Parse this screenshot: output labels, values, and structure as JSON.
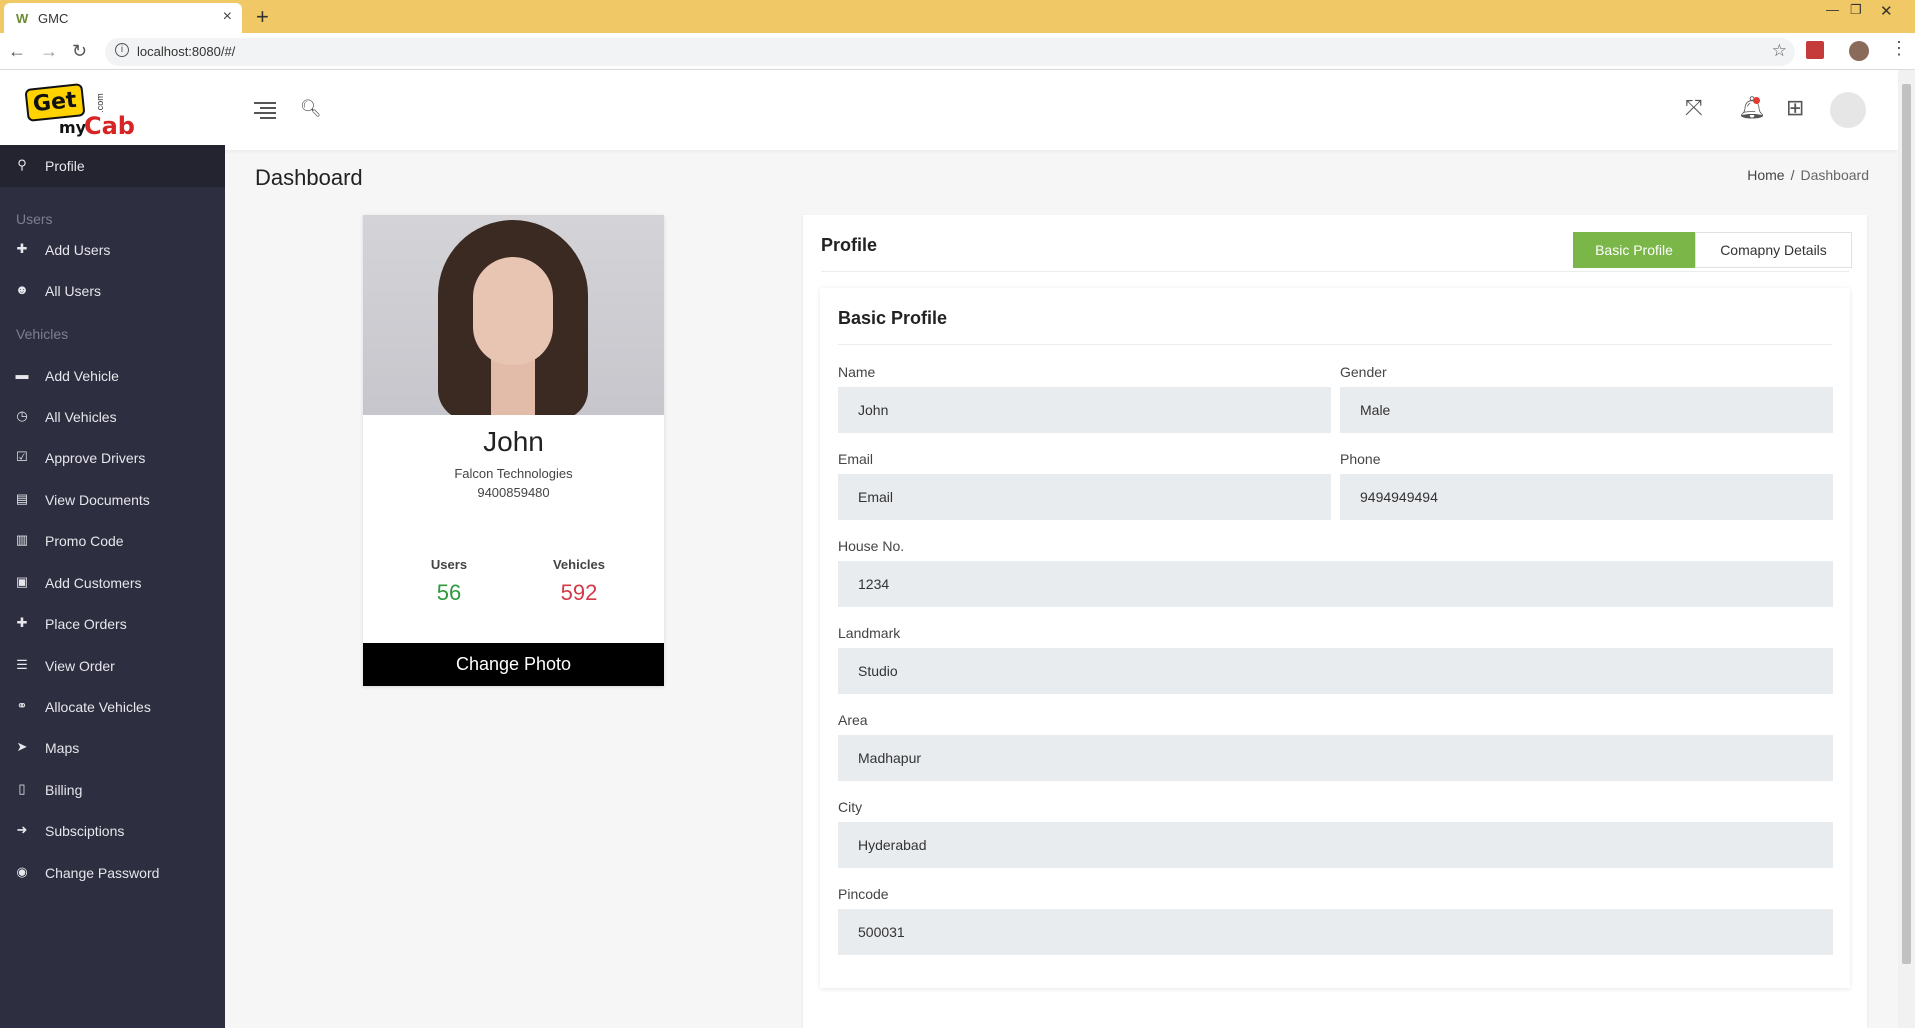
{
  "browser": {
    "tab_title": "GMC",
    "tab_favicon": "W",
    "url": "localhost:8080/#/"
  },
  "logo": {
    "get": "Get",
    "my": "my",
    "cab": "Cab",
    "com": ".com"
  },
  "sidebar": {
    "items": [
      {
        "label": "Profile",
        "icon": "user-icon",
        "glyph": "⚲"
      },
      {
        "section": "Users"
      },
      {
        "label": "Add Users",
        "icon": "add-user-icon",
        "glyph": "✚"
      },
      {
        "label": "All Users",
        "icon": "users-icon",
        "glyph": "☻"
      },
      {
        "section": "Vehicles"
      },
      {
        "label": "Add Vehicle",
        "icon": "car-icon",
        "glyph": "▬"
      },
      {
        "label": "All Vehicles",
        "icon": "clock-icon",
        "glyph": "◷"
      },
      {
        "label": "Approve Drivers",
        "icon": "calendar-check-icon",
        "glyph": "☑"
      },
      {
        "label": "View Documents",
        "icon": "document-icon",
        "glyph": "▤"
      },
      {
        "label": "Promo Code",
        "icon": "barcode-icon",
        "glyph": "▥"
      },
      {
        "label": "Add Customers",
        "icon": "calendar-plus-icon",
        "glyph": "▣"
      },
      {
        "label": "Place Orders",
        "icon": "plus-icon",
        "glyph": "✚"
      },
      {
        "label": "View Order",
        "icon": "list-icon",
        "glyph": "☰"
      },
      {
        "label": "Allocate Vehicles",
        "icon": "bike-icon",
        "glyph": "⚭"
      },
      {
        "label": "Maps",
        "icon": "location-arrow-icon",
        "glyph": "➤"
      },
      {
        "label": "Billing",
        "icon": "file-icon",
        "glyph": "▯"
      },
      {
        "label": "Subsciptions",
        "icon": "sign-in-icon",
        "glyph": "➜"
      },
      {
        "label": "Change Password",
        "icon": "lock-icon",
        "glyph": "◉"
      }
    ]
  },
  "header": {
    "page_title": "Dashboard"
  },
  "breadcrumb": {
    "home": "Home",
    "separator": "/",
    "current": "Dashboard"
  },
  "profile_card": {
    "name": "John",
    "company": "Falcon Technologies",
    "phone": "9400859480",
    "users_label": "Users",
    "users_value": "56",
    "vehicles_label": "Vehicles",
    "vehicles_value": "592",
    "change_photo": "Change Photo"
  },
  "profile_panel": {
    "title": "Profile",
    "tab_basic": "Basic Profile",
    "tab_company": "Comapny Details",
    "section_title": "Basic Profile",
    "fields": {
      "name": {
        "label": "Name",
        "value": "John"
      },
      "gender": {
        "label": "Gender",
        "value": "Male"
      },
      "email": {
        "label": "Email",
        "value": "Email"
      },
      "phone": {
        "label": "Phone",
        "value": "9494949494"
      },
      "house": {
        "label": "House No.",
        "value": "1234"
      },
      "landmark": {
        "label": "Landmark",
        "value": "Studio"
      },
      "area": {
        "label": "Area",
        "value": "Madhapur"
      },
      "city": {
        "label": "City",
        "value": "Hyderabad"
      },
      "pincode": {
        "label": "Pincode",
        "value": "500031"
      }
    }
  },
  "colors": {
    "accent_green": "#7ab648",
    "users_value": "#2e9a3e",
    "vehicles_value": "#d33a48",
    "sidebar_bg": "#2d2e3f"
  }
}
